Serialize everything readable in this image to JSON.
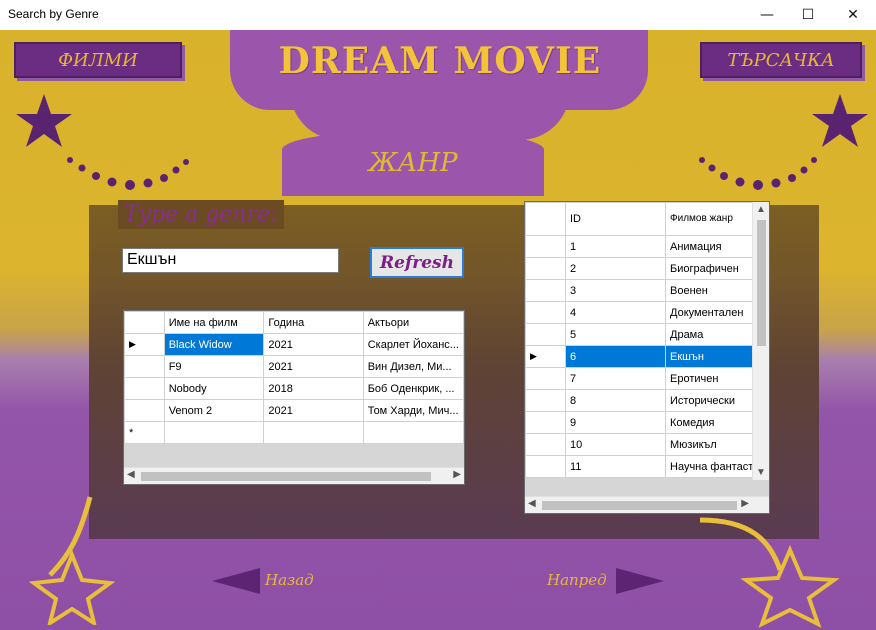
{
  "window": {
    "title": "Search by Genre",
    "minimize": "—",
    "maximize": "☐",
    "close": "✕"
  },
  "header": {
    "brand": "DREAM MOVIE",
    "films_button": "ФИЛМИ",
    "search_button": "ТЪРСАЧКА",
    "section_title": "ЖАНР"
  },
  "search": {
    "prompt": "Type a genre:",
    "value": "Екшън",
    "refresh_label": "Refresh"
  },
  "movies_table": {
    "columns": [
      "Име на филм",
      "Година",
      "Актьори"
    ],
    "rows": [
      [
        "Black Widow",
        "2021",
        "Скарлет Йоханс..."
      ],
      [
        "F9",
        "2021",
        "Вин Дизел, Ми..."
      ],
      [
        "Nobody",
        "2018",
        "Боб Оденкрик, ..."
      ],
      [
        "Venom 2",
        "2021",
        "Том Харди, Мич..."
      ]
    ],
    "current_row_marker": "▶",
    "new_row_marker": "*"
  },
  "genres_table": {
    "columns": [
      "ID",
      "Филмов жанр"
    ],
    "rows": [
      [
        "1",
        "Анимация"
      ],
      [
        "2",
        "Биографичен"
      ],
      [
        "3",
        "Военен"
      ],
      [
        "4",
        "Документален"
      ],
      [
        "5",
        "Драма"
      ],
      [
        "6",
        "Екшън"
      ],
      [
        "7",
        "Еротичен"
      ],
      [
        "8",
        "Исторически"
      ],
      [
        "9",
        "Комедия"
      ],
      [
        "10",
        "Мюзикъл"
      ],
      [
        "11",
        "Научна фантаст..."
      ]
    ],
    "current_row_marker": "▶"
  },
  "navigation": {
    "back_label": "Назад",
    "next_label": "Напред"
  },
  "colors": {
    "gold": "#dcb42e",
    "purple": "#9b56ab",
    "dark_purple": "#6a2d82",
    "selection": "#0078d7"
  }
}
